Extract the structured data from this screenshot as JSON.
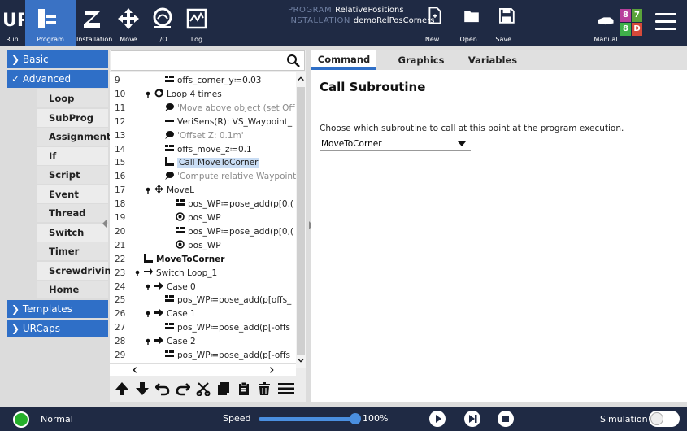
{
  "topbar": {
    "buttons": [
      {
        "label": "Run",
        "icon": "ur-logo-icon"
      },
      {
        "label": "Program",
        "icon": "program-tree-icon"
      },
      {
        "label": "Installation",
        "icon": "installation-icon"
      },
      {
        "label": "Move",
        "icon": "move-arrows-icon"
      },
      {
        "label": "I/O",
        "icon": "io-icon"
      },
      {
        "label": "Log",
        "icon": "log-icon"
      }
    ],
    "program_key": "PROGRAM",
    "program_value": "RelativePositions",
    "installation_key": "INSTALLATION",
    "installation_value": "demoRelPosCorners",
    "file_buttons": [
      {
        "label": "New...",
        "icon": "new-file-icon"
      },
      {
        "label": "Open...",
        "icon": "open-folder-icon"
      },
      {
        "label": "Save...",
        "icon": "save-icon"
      }
    ],
    "mode_label": "Manual",
    "status_codes": [
      "8",
      "7",
      "8",
      "D"
    ]
  },
  "sidebar": {
    "basic": "Basic",
    "advanced": "Advanced",
    "items": [
      "Loop",
      "SubProg",
      "Assignment",
      "If",
      "Script",
      "Event",
      "Thread",
      "Switch",
      "Timer",
      "Screwdriving",
      "Home"
    ],
    "templates": "Templates",
    "urcaps": "URCaps"
  },
  "tree": {
    "rows": [
      {
        "ln": "9",
        "text": "offs_corner_y≔0.03",
        "icon": "assignment",
        "indent": 2
      },
      {
        "ln": "10",
        "text": "Loop 4 times",
        "icon": "loop",
        "indent": 1,
        "toggle": true
      },
      {
        "ln": "11",
        "text": "'Move above object (set Off",
        "icon": "comment",
        "indent": 2,
        "grey": true
      },
      {
        "ln": "12",
        "text": "VeriSens(R): VS_Waypoint_",
        "icon": "minus",
        "indent": 2
      },
      {
        "ln": "13",
        "text": "'Offset Z: 0.1m'",
        "icon": "comment",
        "indent": 2,
        "grey": true
      },
      {
        "ln": "14",
        "text": "offs_move_z≔0.1",
        "icon": "assignment",
        "indent": 2
      },
      {
        "ln": "15",
        "text": "Call MoveToCorner",
        "icon": "call",
        "indent": 2,
        "selected": true
      },
      {
        "ln": "16",
        "text": "'Compute relative Waypoint",
        "icon": "comment",
        "indent": 2,
        "grey": true
      },
      {
        "ln": "17",
        "text": "MoveL",
        "icon": "move",
        "indent": 1,
        "toggle": true
      },
      {
        "ln": "18",
        "text": "pos_WP≔pose_add(p[0,(",
        "icon": "assignment",
        "indent": 3
      },
      {
        "ln": "19",
        "text": "pos_WP",
        "icon": "waypoint",
        "indent": 3
      },
      {
        "ln": "20",
        "text": "pos_WP≔pose_add(p[0,(",
        "icon": "assignment",
        "indent": 3
      },
      {
        "ln": "21",
        "text": "pos_WP",
        "icon": "waypoint",
        "indent": 3
      },
      {
        "ln": "22",
        "text": "MoveToCorner",
        "icon": "call",
        "indent": 0,
        "bold": true
      },
      {
        "ln": "23",
        "text": "Switch Loop_1",
        "icon": "switch",
        "indent": 0,
        "toggle": true
      },
      {
        "ln": "24",
        "text": "Case 0",
        "icon": "arrow",
        "indent": 1,
        "toggle": true
      },
      {
        "ln": "25",
        "text": "pos_WP≔pose_add(p[offs_",
        "icon": "assignment",
        "indent": 2
      },
      {
        "ln": "26",
        "text": "Case 1",
        "icon": "arrow",
        "indent": 1,
        "toggle": true
      },
      {
        "ln": "27",
        "text": "pos_WP≔pose_add(p[-offs",
        "icon": "assignment",
        "indent": 2
      },
      {
        "ln": "28",
        "text": "Case 2",
        "icon": "arrow",
        "indent": 1,
        "toggle": true
      },
      {
        "ln": "29",
        "text": "pos_WP≔pose_add(p[-offs",
        "icon": "assignment",
        "indent": 2
      }
    ]
  },
  "tools": [
    "move-up-icon",
    "move-down-icon",
    "undo-icon",
    "redo-icon",
    "cut-icon",
    "copy-icon",
    "paste-icon",
    "delete-icon",
    "suppress-icon"
  ],
  "tabs": [
    "Command",
    "Graphics",
    "Variables"
  ],
  "command": {
    "title": "Call Subroutine",
    "description": "Choose which subroutine to call at this point at the program execution.",
    "selected": "MoveToCorner"
  },
  "footer": {
    "status": "Normal",
    "speed_label": "Speed",
    "speed_value": "100%",
    "speed_fraction": 1.0,
    "simulation_label": "Simulation"
  },
  "colors": {
    "topbar": "#1f2a44",
    "accent": "#2f6fc7",
    "power_on": "#25b02a"
  }
}
